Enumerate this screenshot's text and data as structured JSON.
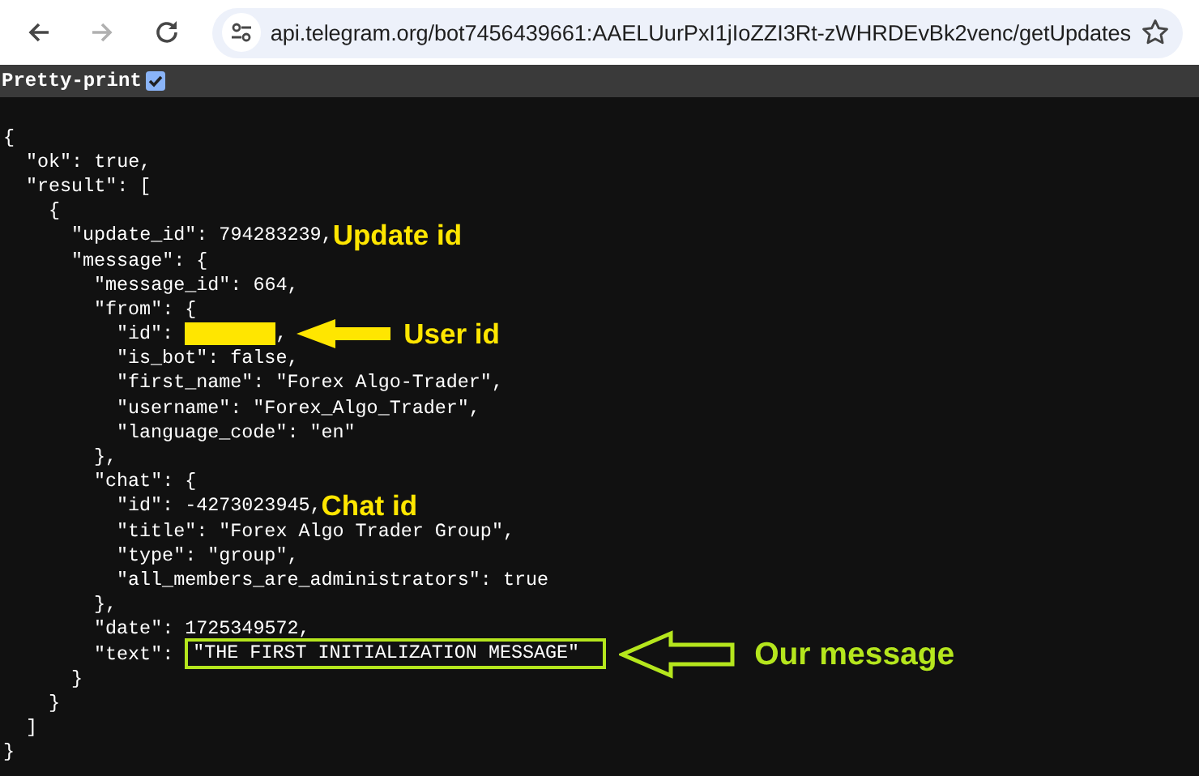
{
  "toolbar": {
    "back": {
      "disabled": false
    },
    "forward": {
      "disabled": true
    },
    "address": "api.telegram.org/bot7456439661:AAELUurPxI1jIoZZI3Rt-zWHRDEvBk2venc/getUpdates"
  },
  "pretty_print": {
    "label": "Pretty-print",
    "checked": true
  },
  "document": {
    "text": "{",
    "end": "}",
    "children": [
      {
        "text": "\"ok\": true,"
      },
      {
        "text": "\"result\": [",
        "end": "]",
        "children": [
          {
            "text": "{",
            "end": "}",
            "children": [
              {
                "text": "\"update_id\": 794283239,",
                "note": {
                  "kind": "label",
                  "text": "Update id",
                  "color": "#ffe600"
                }
              },
              {
                "text": "\"message\": {",
                "end": "}",
                "children": [
                  {
                    "text": "\"message_id\": 664,"
                  },
                  {
                    "text": "\"from\": {",
                    "end": "},",
                    "children": [
                      {
                        "text": "\"id\": ",
                        "redacted": true,
                        "after": ",",
                        "note": {
                          "kind": "arrow-label",
                          "text": "User id",
                          "color": "#ffe600"
                        }
                      },
                      {
                        "text": "\"is_bot\": false,"
                      },
                      {
                        "text": "\"first_name\": \"Forex Algo-Trader\","
                      },
                      {
                        "text": "\"username\": \"Forex_Algo_Trader\","
                      },
                      {
                        "text": "\"language_code\": \"en\""
                      }
                    ]
                  },
                  {
                    "text": "\"chat\": {",
                    "end": "},",
                    "children": [
                      {
                        "text": "\"id\": -4273023945,",
                        "note": {
                          "kind": "label",
                          "text": "Chat id",
                          "color": "#ffe600"
                        }
                      },
                      {
                        "text": "\"title\": \"Forex Algo Trader Group\","
                      },
                      {
                        "text": "\"type\": \"group\","
                      },
                      {
                        "text": "\"all_members_are_administrators\": true"
                      }
                    ]
                  },
                  {
                    "text": "\"date\": 1725349572,"
                  },
                  {
                    "text": "\"text\": ",
                    "boxed": "\"THE FIRST INITIALIZATION MESSAGE\"",
                    "note": {
                      "kind": "outline-arrow-label",
                      "text": "Our message",
                      "color": "#b5e61d"
                    }
                  }
                ]
              }
            ]
          }
        ]
      }
    ]
  }
}
